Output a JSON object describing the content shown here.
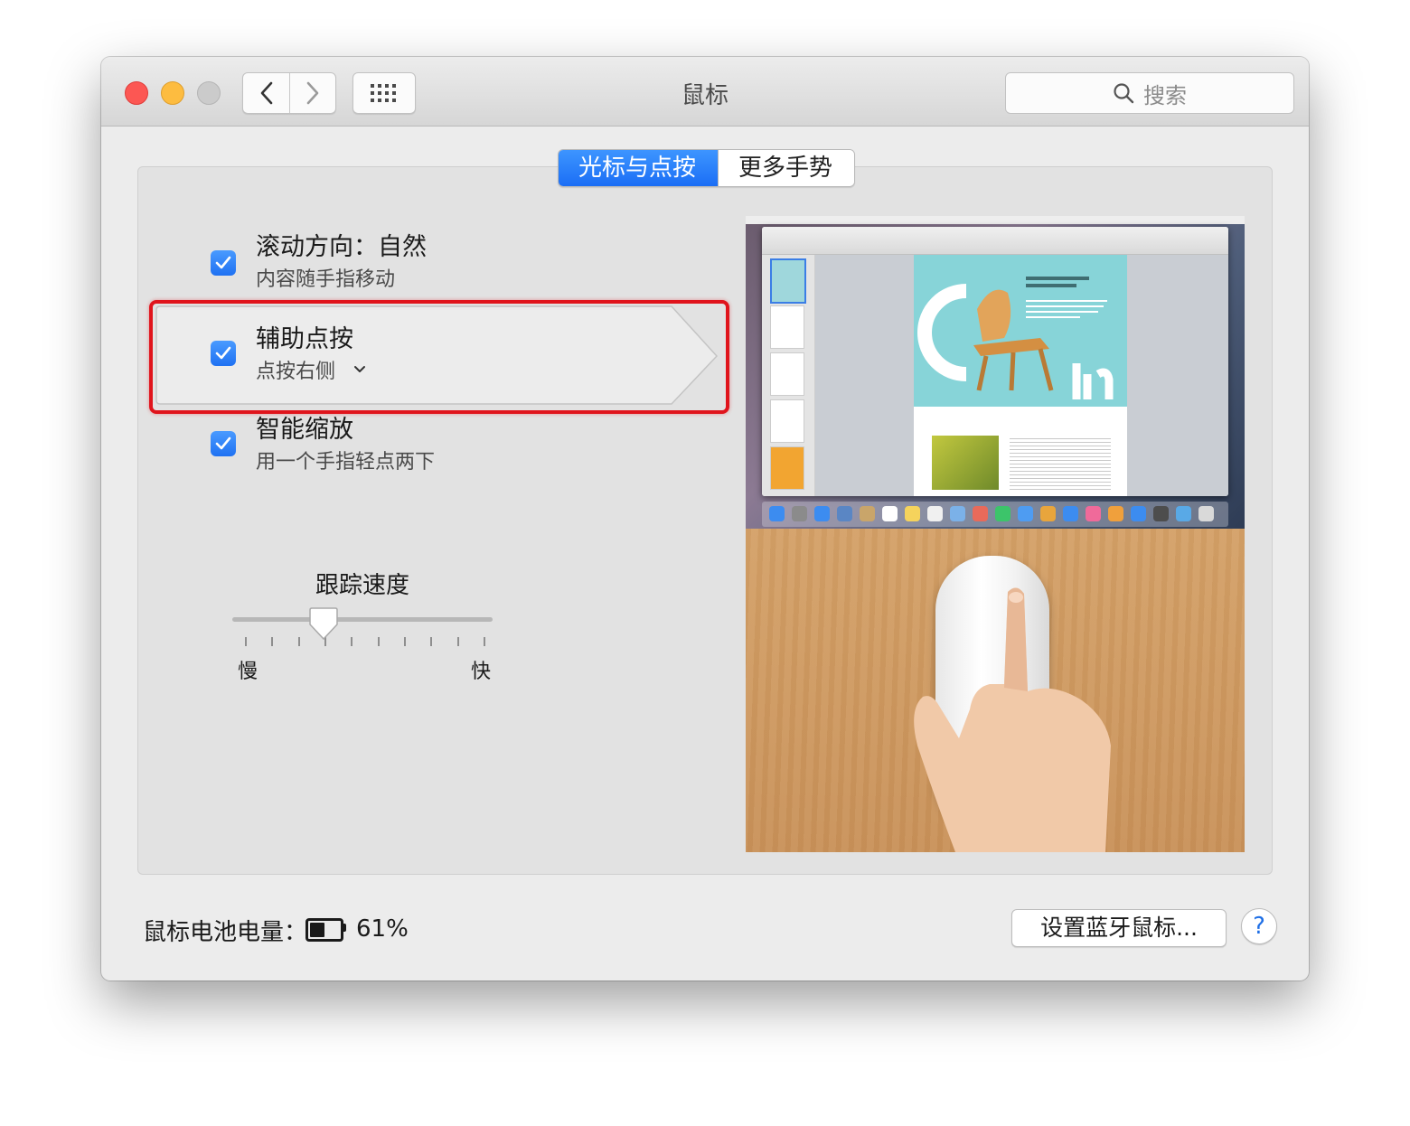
{
  "window": {
    "title": "鼠标"
  },
  "search": {
    "placeholder": "搜索"
  },
  "tabs": [
    {
      "label": "光标与点按",
      "active": true
    },
    {
      "label": "更多手势",
      "active": false
    }
  ],
  "options": [
    {
      "title": "滚动方向：自然",
      "subtitle": "内容随手指移动",
      "checked": true
    },
    {
      "title": "辅助点按",
      "subtitle": "点按右侧",
      "checked": true,
      "has_dropdown": true
    },
    {
      "title": "智能缩放",
      "subtitle": "用一个手指轻点两下",
      "checked": true
    }
  ],
  "tracking": {
    "label": "跟踪速度",
    "min_label": "慢",
    "max_label": "快",
    "tick_count": 10,
    "level_fraction": 0.35
  },
  "battery": {
    "label": "鼠标电池电量：",
    "percent_text": "61%",
    "level": 0.61
  },
  "buttons": {
    "setup": "设置蓝牙鼠标...",
    "help": "?"
  },
  "colors": {
    "accent": "#1f71f2",
    "highlight": "#e0141c",
    "close": "#fc5753",
    "minimize": "#fdbc40"
  }
}
